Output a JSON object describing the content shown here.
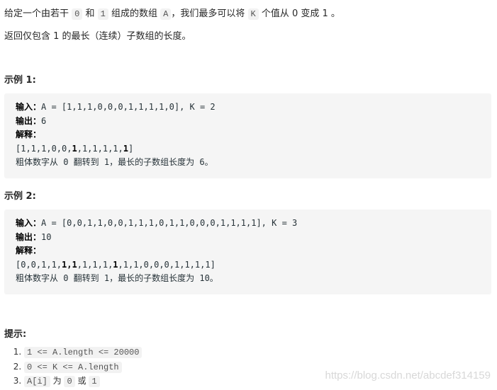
{
  "intro": {
    "t1": "给定一个由若干",
    "c1": "0",
    "t2": "和",
    "c2": "1",
    "t3": "组成的数组",
    "c3": "A",
    "t4": "，我们最多可以将",
    "c4": "K",
    "t5": "个值从 0 变成 1 。"
  },
  "goal": "返回仅包含 1 的最长（连续）子数组的长度。",
  "example1": {
    "heading": "示例 1:",
    "input_label": "输入：",
    "input": "A = [1,1,1,0,0,0,1,1,1,1,0], K = 2",
    "output_label": "输出：",
    "output": "6",
    "explain_label": "解释：",
    "array_pre": "[1,1,1,0,0,",
    "array_b1": "1",
    "array_mid": ",1,1,1,1,",
    "array_b2": "1",
    "array_post": "]",
    "explanation": "粗体数字从 0 翻转到 1，最长的子数组长度为 6。"
  },
  "example2": {
    "heading": "示例 2:",
    "input_label": "输入：",
    "input": "A = [0,0,1,1,0,0,1,1,1,0,1,1,0,0,0,1,1,1,1], K = 3",
    "output_label": "输出：",
    "output": "10",
    "explain_label": "解释：",
    "array_pre": "[0,0,1,1,",
    "array_b1": "1,1",
    "array_mid": ",1,1,1,",
    "array_b2": "1",
    "array_post": ",1,1,0,0,0,1,1,1,1]",
    "explanation": "粗体数字从 0 翻转到 1，最长的子数组长度为 10。"
  },
  "hints": {
    "heading": "提示:",
    "items": [
      {
        "code": "1 <= A.length <= 20000"
      },
      {
        "code": "0 <= K <= A.length"
      },
      {
        "c1": "A[i]",
        "t1": "为",
        "c2": "0",
        "t2": "或",
        "c3": "1"
      }
    ]
  },
  "watermark": "https://blog.csdn.net/abcdef314159"
}
